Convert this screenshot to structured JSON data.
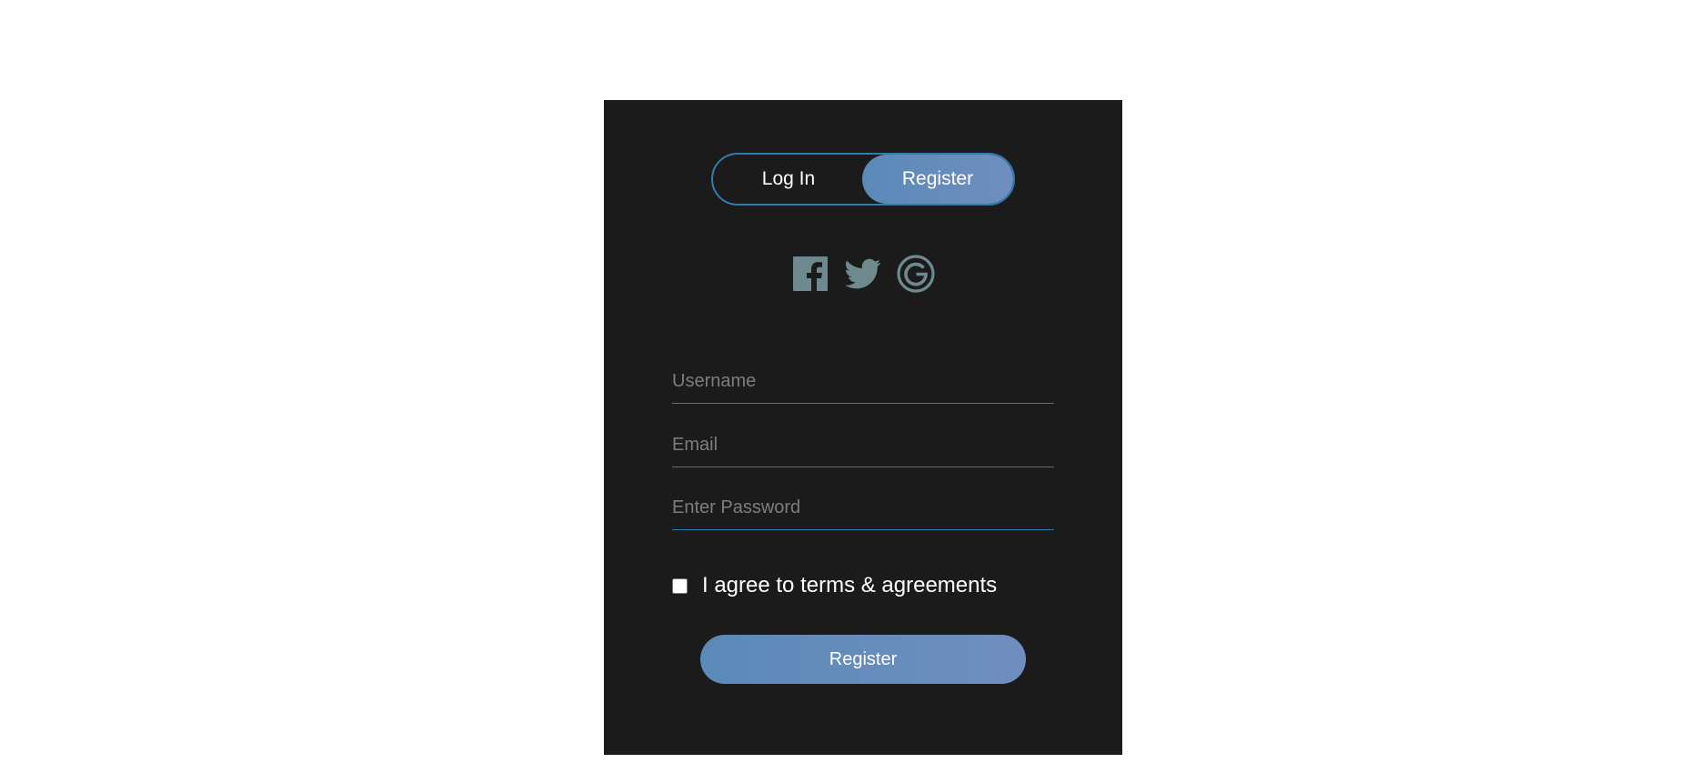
{
  "tabs": {
    "login_label": "Log In",
    "register_label": "Register",
    "active": "register"
  },
  "social": {
    "icons": [
      "facebook-icon",
      "twitter-icon",
      "google-icon"
    ],
    "icon_color": "#6e8a8e"
  },
  "form": {
    "username_placeholder": "Username",
    "email_placeholder": "Email",
    "password_placeholder": "Enter Password",
    "agree_label": "I agree to terms & agreements",
    "agree_checked": false,
    "submit_label": "Register"
  },
  "colors": {
    "card_bg": "#1b1b1b",
    "accent_border": "#2f7dae",
    "button_gradient_start": "#5b8ab8",
    "button_gradient_end": "#6f8ebf"
  }
}
